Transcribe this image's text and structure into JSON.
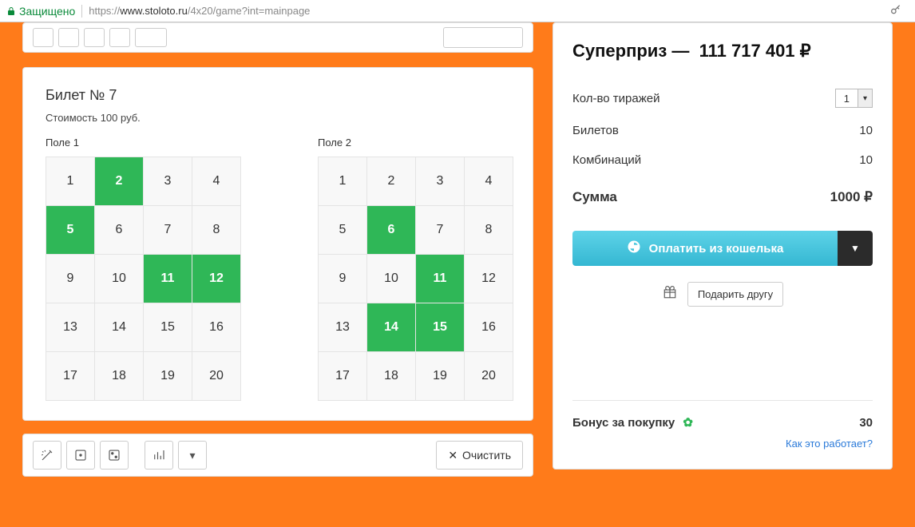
{
  "browser": {
    "secure_label": "Защищено",
    "url_prefix": "https://",
    "url_domain": "www.stoloto.ru",
    "url_path": "/4x20/game?int=mainpage"
  },
  "ticket": {
    "title": "Билет № 7",
    "cost": "Стоимость 100 руб.",
    "field1_label": "Поле 1",
    "field2_label": "Поле 2",
    "numbers": [
      1,
      2,
      3,
      4,
      5,
      6,
      7,
      8,
      9,
      10,
      11,
      12,
      13,
      14,
      15,
      16,
      17,
      18,
      19,
      20
    ],
    "selected_field1": [
      2,
      5,
      11,
      12
    ],
    "selected_field2": [
      6,
      11,
      14,
      15
    ]
  },
  "actions": {
    "clear_label": "Очистить"
  },
  "sidebar": {
    "superprize_label": "Суперприз —",
    "superprize_value": "111 717 401 ₽",
    "draws_label": "Кол-во тиражей",
    "draws_value": "1",
    "tickets_label": "Билетов",
    "tickets_value": "10",
    "combos_label": "Комбинаций",
    "combos_value": "10",
    "sum_label": "Сумма",
    "sum_value": "1000 ₽",
    "pay_label": "Оплатить из кошелька",
    "gift_label": "Подарить другу",
    "bonus_label": "Бонус за покупку",
    "bonus_value": "30",
    "bonus_link": "Как это работает?"
  }
}
